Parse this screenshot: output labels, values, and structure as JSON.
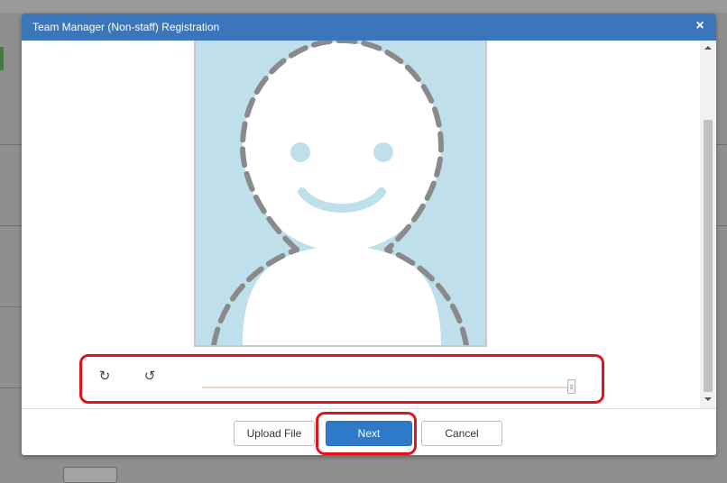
{
  "dialog": {
    "title": "Team Manager (Non-staff) Registration",
    "close_icon": "close-icon",
    "close_glyph": "×"
  },
  "photo": {
    "placeholder_icon": "person-placeholder-icon",
    "background_color": "#bfe0ea"
  },
  "controls": {
    "rotate_clockwise_icon": "rotate-clockwise-icon",
    "rotate_clockwise_glyph": "↻",
    "rotate_counterclockwise_icon": "rotate-counterclockwise-icon",
    "rotate_counterclockwise_glyph": "↺",
    "zoom_level": 1.0
  },
  "footer": {
    "upload_label": "Upload File",
    "next_label": "Next",
    "cancel_label": "Cancel"
  },
  "colors": {
    "title_bar": "#3b76bb",
    "primary_button": "#2f79c9",
    "highlight": "#e0141e"
  }
}
